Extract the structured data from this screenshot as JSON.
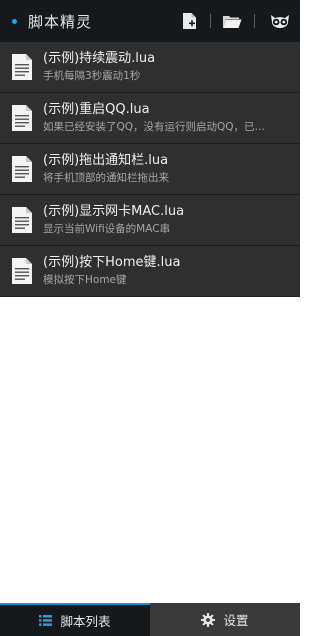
{
  "header": {
    "title": "脚本精灵",
    "accent_color": "#1fa8e8",
    "actions": [
      {
        "icon": "new-file-icon"
      },
      {
        "icon": "folder-icon"
      },
      {
        "icon": "owl-icon"
      }
    ]
  },
  "scripts": [
    {
      "name": "(示例)持续震动.lua",
      "desc": "手机每隔3秒震动1秒"
    },
    {
      "name": "(示例)重启QQ.lua",
      "desc": "如果已经安装了QQ，没有运行则启动QQ，已…"
    },
    {
      "name": "(示例)拖出通知栏.lua",
      "desc": "将手机顶部的通知栏拖出来"
    },
    {
      "name": "(示例)显示网卡MAC.lua",
      "desc": "显示当前Wifi设备的MAC串"
    },
    {
      "name": "(示例)按下Home键.lua",
      "desc": "模拟按下Home键"
    }
  ],
  "tabs": {
    "scripts": {
      "label": "脚本列表",
      "icon": "list-icon"
    },
    "settings": {
      "label": "设置",
      "icon": "gear-icon"
    }
  }
}
